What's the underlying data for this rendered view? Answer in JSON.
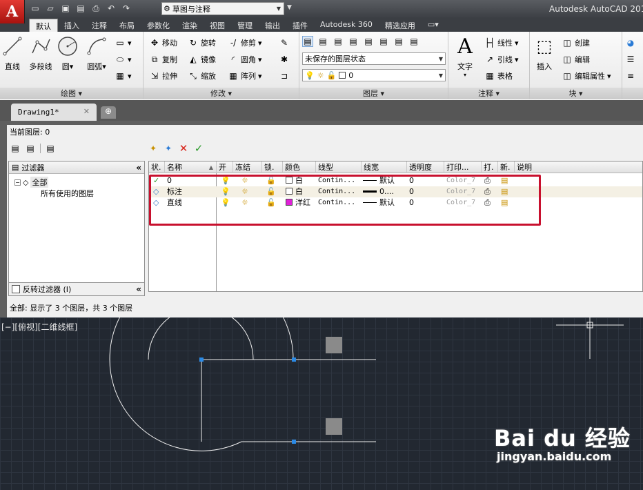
{
  "app": {
    "logo_letter": "A",
    "title": "Autodesk AutoCAD 201"
  },
  "qat": {
    "workspace": "草图与注释"
  },
  "ribbon_tabs": [
    "默认",
    "插入",
    "注释",
    "布局",
    "参数化",
    "渲染",
    "视图",
    "管理",
    "输出",
    "插件",
    "Autodesk 360",
    "精选应用"
  ],
  "ribbon": {
    "draw": {
      "title": "绘图 ▾",
      "line": "直线",
      "polyline": "多段线",
      "circle": "圆",
      "arc": "圆弧"
    },
    "modify": {
      "title": "修改 ▾",
      "move": "移动",
      "rotate": "旋转",
      "trim": "修剪",
      "copy": "复制",
      "mirror": "镜像",
      "fillet": "圆角",
      "stretch": "拉伸",
      "scale": "缩放",
      "array": "阵列"
    },
    "layers": {
      "title": "图层 ▾",
      "state": "未保存的图层状态",
      "current": "0"
    },
    "annotation": {
      "title": "注释 ▾",
      "text": "文字",
      "linear": "线性",
      "leader": "引线",
      "table": "表格"
    },
    "block": {
      "title": "块 ▾",
      "insert": "插入",
      "create": "创建",
      "edit": "编辑",
      "edit_attr": "编辑属性"
    }
  },
  "doc_tab": {
    "name": "Drawing1*"
  },
  "lpm": {
    "current_layer": "当前图层: 0",
    "filter_header": "过滤器",
    "tree_all": "全部",
    "tree_used": "所有使用的图层",
    "invert_filter": "反转过滤器 (I)",
    "columns": [
      "状.",
      "名称",
      "开",
      "冻结",
      "锁.",
      "颜色",
      "线型",
      "线宽",
      "透明度",
      "打印...",
      "打.",
      "新.",
      "说明"
    ],
    "layers": [
      {
        "name": "0",
        "color": "白",
        "swatch": "#ffffff",
        "linetype": "Contin...",
        "lineweight": "默认",
        "transparency": "0",
        "plotstyle": "Color_7"
      },
      {
        "name": "标注",
        "color": "白",
        "swatch": "#ffffff",
        "linetype": "Contin...",
        "lineweight": "0....",
        "transparency": "0",
        "plotstyle": "Color_7"
      },
      {
        "name": "直线",
        "color": "洋红",
        "swatch": "#e020d8",
        "linetype": "Contin...",
        "lineweight": "默认",
        "transparency": "0",
        "plotstyle": "Color_7"
      }
    ],
    "status": "全部: 显示了 3 个图层，共 3 个图层"
  },
  "viewport": {
    "label": "[−][俯视][二维线框]"
  },
  "watermark": {
    "main": "Bai du 经验",
    "url": "jingyan.baidu.com"
  }
}
